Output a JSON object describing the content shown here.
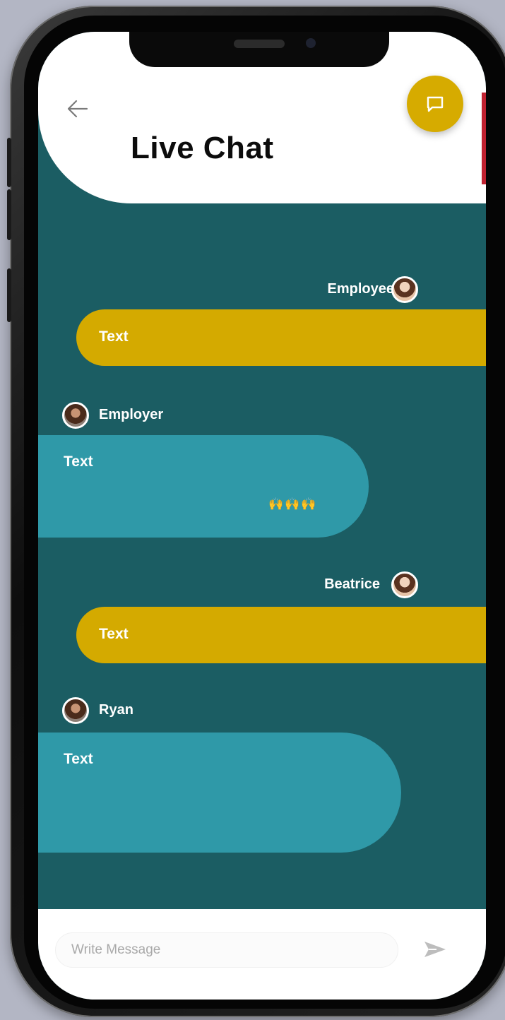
{
  "header": {
    "title": "Live Chat"
  },
  "messages": [
    {
      "sender": "Employee",
      "side": "right",
      "text": "Text",
      "reactions": ""
    },
    {
      "sender": "Employer",
      "side": "left",
      "text": "Text",
      "reactions": "🙌🙌🙌"
    },
    {
      "sender": "Beatrice",
      "side": "right",
      "text": "Text",
      "reactions": ""
    },
    {
      "sender": "Ryan",
      "side": "left",
      "text": "Text",
      "reactions": ""
    }
  ],
  "composer": {
    "placeholder": "Write Message",
    "value": ""
  },
  "icons": {
    "back": "arrow-left-icon",
    "chat": "chat-bubble-icon",
    "send": "send-icon"
  },
  "colors": {
    "background_teal": "#1b5d63",
    "bubble_yellow": "#d4aa00",
    "bubble_teal": "#2f99a8",
    "accent": "#d6ab00"
  }
}
